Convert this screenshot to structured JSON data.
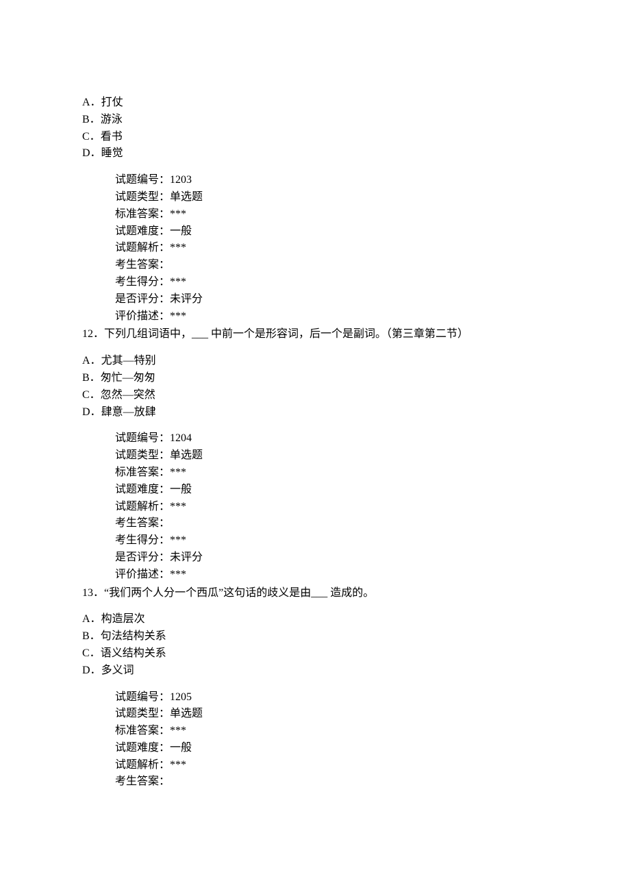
{
  "questions": [
    {
      "options": {
        "prefixA": "A．",
        "A": "打仗",
        "prefixB": "B．",
        "B": "游泳",
        "prefixC": "C．",
        "C": "看书",
        "prefixD": "D．",
        "D": "睡觉"
      },
      "meta": {
        "id_label": "试题编号：",
        "id_value": "1203",
        "type_label": "试题类型：",
        "type_value": "单选题",
        "answer_label": "标准答案：",
        "answer_value": "***",
        "difficulty_label": "试题难度：",
        "difficulty_value": "一般",
        "analysis_label": "试题解析：",
        "analysis_value": "***",
        "student_answer_label": "考生答案：",
        "student_answer_value": "",
        "student_score_label": "考生得分：",
        "student_score_value": "***",
        "graded_label": "是否评分：",
        "graded_value": "未评分",
        "desc_label": "评价描述：",
        "desc_value": "***"
      }
    },
    {
      "number": "12．",
      "text": "下列几组词语中，___ 中前一个是形容词，后一个是副词。（第三章第二节）",
      "options": {
        "prefixA": "A．",
        "A": "尤其—特别",
        "prefixB": "B．",
        "B": "匆忙—匆匆",
        "prefixC": "C．",
        "C": "忽然—突然",
        "prefixD": "D．",
        "D": "肆意—放肆"
      },
      "meta": {
        "id_label": "试题编号：",
        "id_value": "1204",
        "type_label": "试题类型：",
        "type_value": "单选题",
        "answer_label": "标准答案：",
        "answer_value": "***",
        "difficulty_label": "试题难度：",
        "difficulty_value": "一般",
        "analysis_label": "试题解析：",
        "analysis_value": "***",
        "student_answer_label": "考生答案：",
        "student_answer_value": "",
        "student_score_label": "考生得分：",
        "student_score_value": "***",
        "graded_label": "是否评分：",
        "graded_value": "未评分",
        "desc_label": "评价描述：",
        "desc_value": "***"
      }
    },
    {
      "number": "13．",
      "text": "“我们两个人分一个西瓜”这句话的歧义是由___ 造成的。",
      "options": {
        "prefixA": "A．",
        "A": "构造层次",
        "prefixB": "B．",
        "B": "句法结构关系",
        "prefixC": "C．",
        "C": "语义结构关系",
        "prefixD": "D．",
        "D": "多义词"
      },
      "meta": {
        "id_label": "试题编号：",
        "id_value": "1205",
        "type_label": "试题类型：",
        "type_value": "单选题",
        "answer_label": "标准答案：",
        "answer_value": "***",
        "difficulty_label": "试题难度：",
        "difficulty_value": "一般",
        "analysis_label": "试题解析：",
        "analysis_value": "***",
        "student_answer_label": "考生答案：",
        "student_answer_value": ""
      }
    }
  ]
}
